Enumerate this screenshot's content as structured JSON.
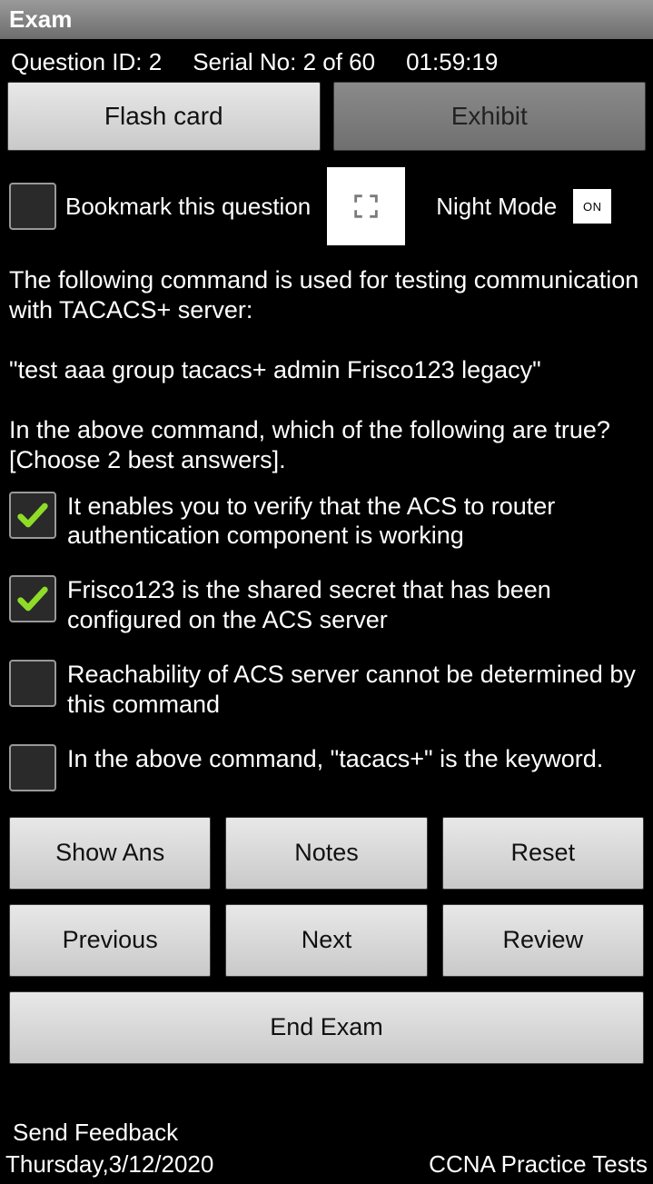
{
  "title": "Exam",
  "meta": {
    "question_id_label": "Question ID: 2",
    "serial_label": "Serial No: 2 of 60",
    "timer": "01:59:19"
  },
  "top_buttons": {
    "flash_card": "Flash card",
    "exhibit": "Exhibit"
  },
  "bookmark": {
    "label": "Bookmark this question",
    "checked": false
  },
  "night_mode": {
    "label": "Night Mode",
    "state": "ON"
  },
  "question_text": "The following command is used for testing communication with TACACS+ server:\n\n\"test aaa group tacacs+ admin Frisco123 legacy\"\n\nIn the above command, which of the following are true? [Choose 2 best answers].",
  "answers": [
    {
      "text": "It enables you to verify that the ACS to router authentication component is working",
      "checked": true
    },
    {
      "text": "Frisco123 is the shared secret that has been configured on the ACS server",
      "checked": true
    },
    {
      "text": "Reachability of ACS server cannot be determined by this command",
      "checked": false
    },
    {
      "text": "In the above command, \"tacacs+\" is the keyword.",
      "checked": false
    }
  ],
  "buttons": {
    "show_ans": "Show Ans",
    "notes": "Notes",
    "reset": "Reset",
    "previous": "Previous",
    "next": "Next",
    "review": "Review",
    "end_exam": "End Exam"
  },
  "footer": {
    "feedback": "Send Feedback",
    "date": "Thursday,3/12/2020",
    "brand": "CCNA Practice Tests"
  }
}
